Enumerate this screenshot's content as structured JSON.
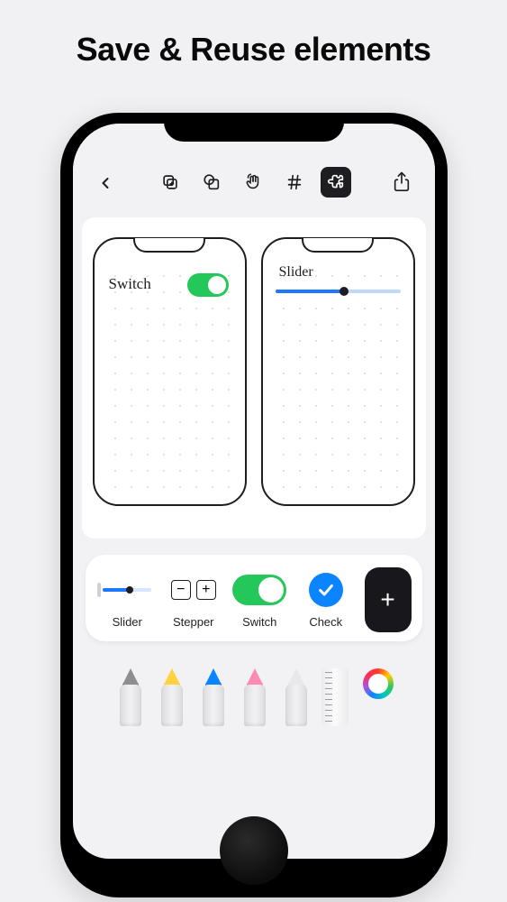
{
  "headline": "Save & Reuse elements",
  "mockups": {
    "left_label": "Switch",
    "right_label": "Slider"
  },
  "tray": {
    "slider_label": "Slider",
    "stepper_label": "Stepper",
    "stepper_minus": "−",
    "stepper_plus": "+",
    "switch_label": "Switch",
    "check_label": "Check",
    "add_label": "+"
  }
}
